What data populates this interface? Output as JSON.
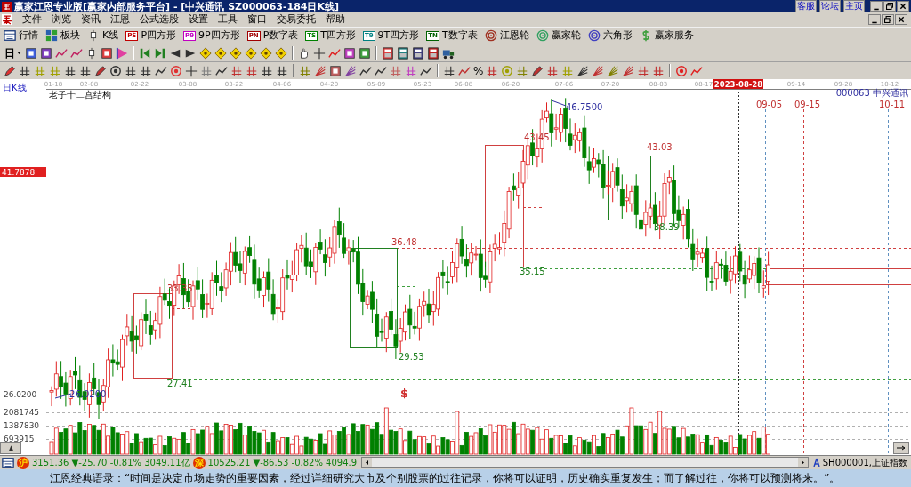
{
  "window": {
    "title": "赢家江恩专业版[赢家内部服务平台] - [中兴通讯    SZ000063-184日K线]",
    "links": [
      "客服",
      "论坛",
      "主页"
    ]
  },
  "menu": [
    "文件",
    "浏览",
    "资讯",
    "江恩",
    "公式选股",
    "设置",
    "工具",
    "窗口",
    "交易委托",
    "帮助"
  ],
  "toolbar": [
    {
      "kind": "icon",
      "label": "行情"
    },
    {
      "kind": "icon",
      "label": "板块"
    },
    {
      "kind": "icon",
      "label": "K线"
    },
    {
      "kind": "badge",
      "badge": "PS",
      "label": "P四方形",
      "color": "#c00000"
    },
    {
      "kind": "badge",
      "badge": "P9",
      "label": "9P四方形",
      "color": "#c000c0"
    },
    {
      "kind": "badge",
      "badge": "PN",
      "label": "P数字表",
      "color": "#a00000"
    },
    {
      "kind": "badge",
      "badge": "TS",
      "label": "T四方形",
      "color": "#008000"
    },
    {
      "kind": "badge",
      "badge": "T9",
      "label": "9T四方形",
      "color": "#008080"
    },
    {
      "kind": "badge",
      "badge": "TN",
      "label": "T数字表",
      "color": "#006000"
    },
    {
      "kind": "icon",
      "label": "江恩轮"
    },
    {
      "kind": "icon",
      "label": "赢家轮"
    },
    {
      "kind": "icon",
      "label": "六角形"
    },
    {
      "kind": "icon",
      "label": "赢家服务"
    }
  ],
  "period_dropdown": "日",
  "toolbar_percent": "%",
  "chart": {
    "period_label": "日K线",
    "title": "老子十二宫结构",
    "stock": "000063  中兴通讯",
    "dates": [
      {
        "text": "01-18",
        "selected": false
      },
      {
        "text": "02-08",
        "selected": false
      },
      {
        "text": "02-22",
        "selected": false
      },
      {
        "text": "03-08",
        "selected": false
      },
      {
        "text": "03-22",
        "selected": false
      },
      {
        "text": "04-06",
        "selected": false
      },
      {
        "text": "04-20",
        "selected": false
      },
      {
        "text": "05-09",
        "selected": false
      },
      {
        "text": "05-23",
        "selected": false
      },
      {
        "text": "06-08",
        "selected": false
      },
      {
        "text": "06-20",
        "selected": false
      },
      {
        "text": "07-06",
        "selected": false
      },
      {
        "text": "07-20",
        "selected": false
      },
      {
        "text": "08-03",
        "selected": false
      },
      {
        "text": "08-17",
        "selected": false
      },
      {
        "text": "2023-08-28",
        "selected": true
      },
      {
        "text": "09-14",
        "selected": false
      },
      {
        "text": "09-28",
        "selected": false
      },
      {
        "text": "10-12",
        "selected": false
      }
    ],
    "cursor_price": "41.7878",
    "price_label": "26.0200",
    "volume_labels": [
      "2081745",
      "1387830",
      "693915"
    ],
    "annotations": [
      {
        "text": "46.7500",
        "color": "#3030a0"
      },
      {
        "text": "43.45",
        "color": "#c03030"
      },
      {
        "text": "43.03",
        "color": "#c03030"
      },
      {
        "text": "38.39",
        "color": "#208020"
      },
      {
        "text": "36.48",
        "color": "#c03030"
      },
      {
        "text": "35.15",
        "color": "#208020"
      },
      {
        "text": "33.35",
        "color": "#c03030"
      },
      {
        "text": "29.53",
        "color": "#208020"
      },
      {
        "text": "27.41",
        "color": "#208020"
      },
      {
        "text": "26.0200",
        "color": "#3030a0"
      },
      {
        "text": "09-05",
        "color": "#c03030"
      },
      {
        "text": "09-15",
        "color": "#c03030"
      },
      {
        "text": "10-11",
        "color": "#c03030"
      },
      {
        "text": "$",
        "color": "#d03030"
      }
    ]
  },
  "status_bar": {
    "sh_badge": "沪",
    "sh_index": "3151.36 ▼-25.70 -0.81% 3049.11亿",
    "sz_badge": "深",
    "sz_index": "10525.21 ▼-86.53 -0.82% 4094.9",
    "index_code": "SH000001,上证指数"
  },
  "footer": "江恩经典语录：“时间是决定市场走势的重要因素，经过详细研究大市及个别股票的过往记录，你将可以证明，历史确实重复发生；而了解过往，你将可以预测将来。”。"
}
